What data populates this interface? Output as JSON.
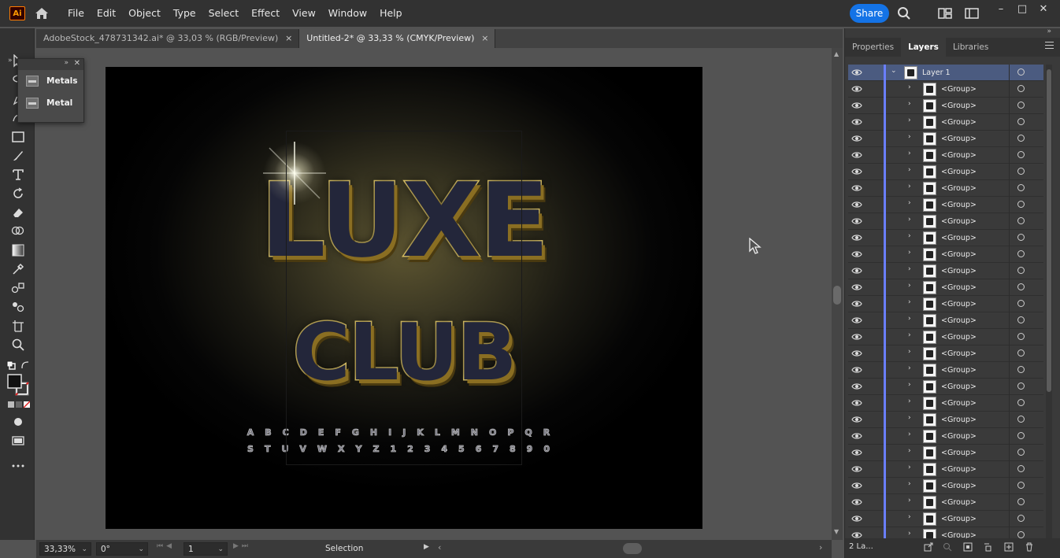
{
  "app": {
    "logo_text": "Ai"
  },
  "menu": [
    "File",
    "Edit",
    "Object",
    "Type",
    "Select",
    "Effect",
    "View",
    "Window",
    "Help"
  ],
  "share_label": "Share",
  "tabs": [
    {
      "title": "AdobeStock_478731342.ai* @ 33,03 % (RGB/Preview)",
      "close": "×"
    },
    {
      "title": "Untitled-2* @ 33,33 % (CMYK/Preview)",
      "close": "×"
    }
  ],
  "swatches_popup": {
    "items": [
      "Metals",
      "Metal"
    ]
  },
  "artwork": {
    "line1": "LUXE",
    "line2": "CLUB",
    "alphabet1": "ABCDEFGHIJKLMNOPQR",
    "alphabet2": "STUVWXYZ1234567890"
  },
  "status": {
    "zoom": "33,33%",
    "rotation": "0°",
    "artboard": "1",
    "tool": "Selection"
  },
  "panel": {
    "tabs": [
      "Properties",
      "Layers",
      "Libraries"
    ],
    "active_tab": "Layers",
    "layer_name": "Layer 1",
    "group_label": "<Group>",
    "layer_count": "2 La..."
  },
  "colors": {
    "accent": "#1473e6",
    "layer_color": "#6a7fff",
    "gold": "#e7cd6c"
  }
}
